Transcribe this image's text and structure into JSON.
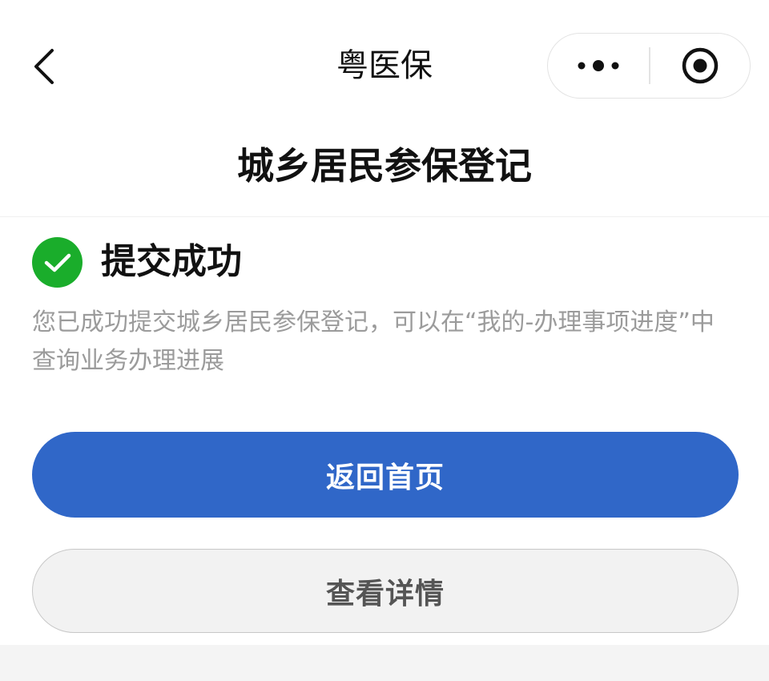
{
  "navbar": {
    "title": "粤医保",
    "back_icon": "chevron-left-icon",
    "more_icon": "more-dots-icon",
    "close_icon": "target-circle-icon"
  },
  "page": {
    "heading": "城乡居民参保登记"
  },
  "result": {
    "icon": "check-circle-icon",
    "icon_color": "#1aad2b",
    "title": "提交成功",
    "description": "您已成功提交城乡居民参保登记，可以在“我的-办理事项进度”中查询业务办理进展"
  },
  "actions": {
    "primary_label": "返回首页",
    "primary_color": "#3067c8",
    "secondary_label": "查看详情"
  }
}
